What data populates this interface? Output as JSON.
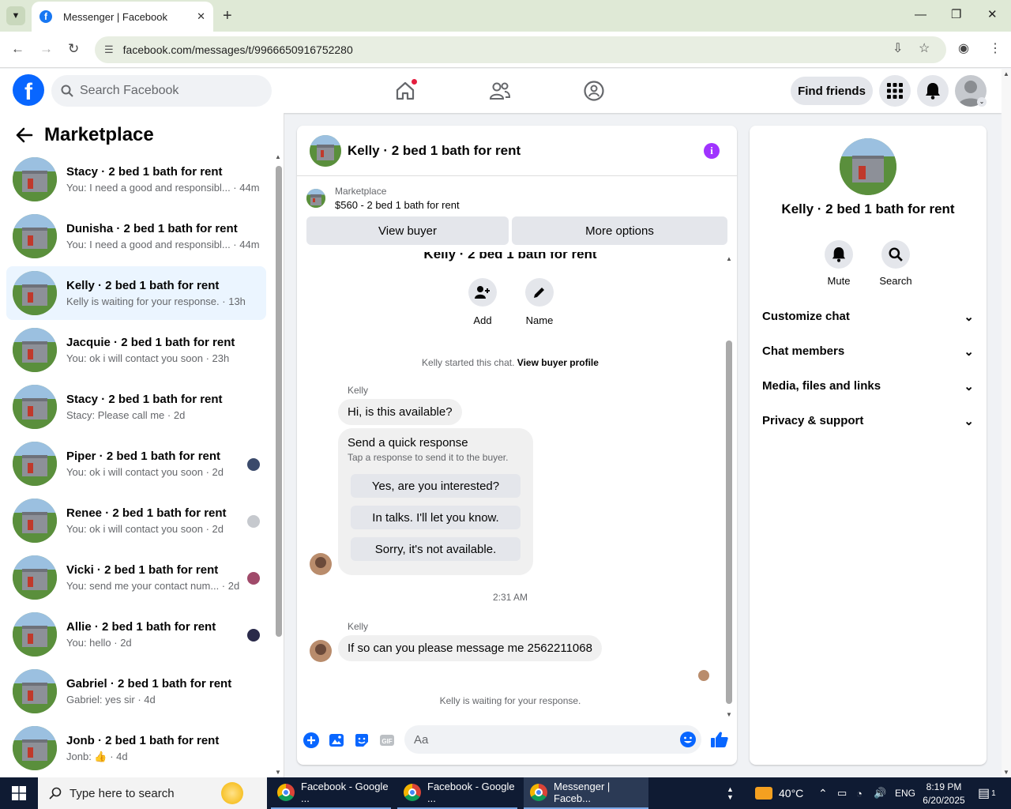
{
  "browser": {
    "tab_title": "Messenger | Facebook",
    "url": "facebook.com/messages/t/9966650916752280"
  },
  "header": {
    "search_placeholder": "Search Facebook",
    "find_friends": "Find friends"
  },
  "sidebar": {
    "title": "Marketplace",
    "conversations": [
      {
        "name": "Stacy · 2 bed 1 bath for rent",
        "preview": "You: I need a good and responsibl...",
        "time": "44m"
      },
      {
        "name": "Dunisha · 2 bed 1 bath for rent",
        "preview": "You: I need a good and responsibl...",
        "time": "44m"
      },
      {
        "name": "Kelly · 2 bed 1 bath for rent",
        "preview": "Kelly is waiting for your response.",
        "time": "13h",
        "selected": true
      },
      {
        "name": "Jacquie · 2 bed 1 bath for rent",
        "preview": "You: ok i will contact you soon",
        "time": "23h"
      },
      {
        "name": "Stacy · 2 bed 1 bath for rent",
        "preview": "Stacy: Please call me",
        "time": "2d"
      },
      {
        "name": "Piper · 2 bed 1 bath for rent",
        "preview": "You: ok i will contact you soon",
        "time": "2d"
      },
      {
        "name": "Renee · 2 bed 1 bath for rent",
        "preview": "You: ok i will contact you soon",
        "time": "2d"
      },
      {
        "name": "Vicki · 2 bed 1 bath for rent",
        "preview": "You: send me your contact num...",
        "time": "2d"
      },
      {
        "name": "Allie · 2 bed 1 bath for rent",
        "preview": "You: hello",
        "time": "2d"
      },
      {
        "name": "Gabriel · 2 bed 1 bath for rent",
        "preview": "Gabriel: yes sir",
        "time": "4d"
      },
      {
        "name": "Jonb · 2 bed 1 bath for rent",
        "preview": "Jonb: 👍",
        "time": "4d"
      }
    ]
  },
  "chat": {
    "title": "Kelly · 2 bed 1 bath for rent",
    "marketplace_label": "Marketplace",
    "listing": "$560 - 2 bed 1 bath for rent",
    "view_buyer": "View buyer",
    "more_options": "More options",
    "header_name": "Kelly · 2 bed 1 bath for rent",
    "add_label": "Add",
    "name_label": "Name",
    "started_text": "Kelly started this chat.",
    "view_buyer_profile": "View buyer profile",
    "sender": "Kelly",
    "msg1": "Hi, is this available?",
    "quick_title": "Send a quick response",
    "quick_sub": "Tap a response to send it to the buyer.",
    "quick_options": [
      "Yes, are you interested?",
      "In talks. I'll let you know.",
      "Sorry, it's not available."
    ],
    "timestamp": "2:31 AM",
    "msg2": "If so can you please message me 2562211068",
    "waiting": "Kelly is waiting for your response.",
    "composer_placeholder": "Aa"
  },
  "details": {
    "name": "Kelly · 2 bed 1 bath for rent",
    "mute": "Mute",
    "search": "Search",
    "sections": [
      "Customize chat",
      "Chat members",
      "Media, files and links",
      "Privacy & support"
    ]
  },
  "taskbar": {
    "search_placeholder": "Type here to search",
    "apps": [
      "Facebook - Google ...",
      "Facebook - Google ...",
      "Messenger | Faceb..."
    ],
    "temp": "40°C",
    "lang": "ENG",
    "time": "8:19 PM",
    "date": "6/20/2025",
    "notif": "1"
  }
}
